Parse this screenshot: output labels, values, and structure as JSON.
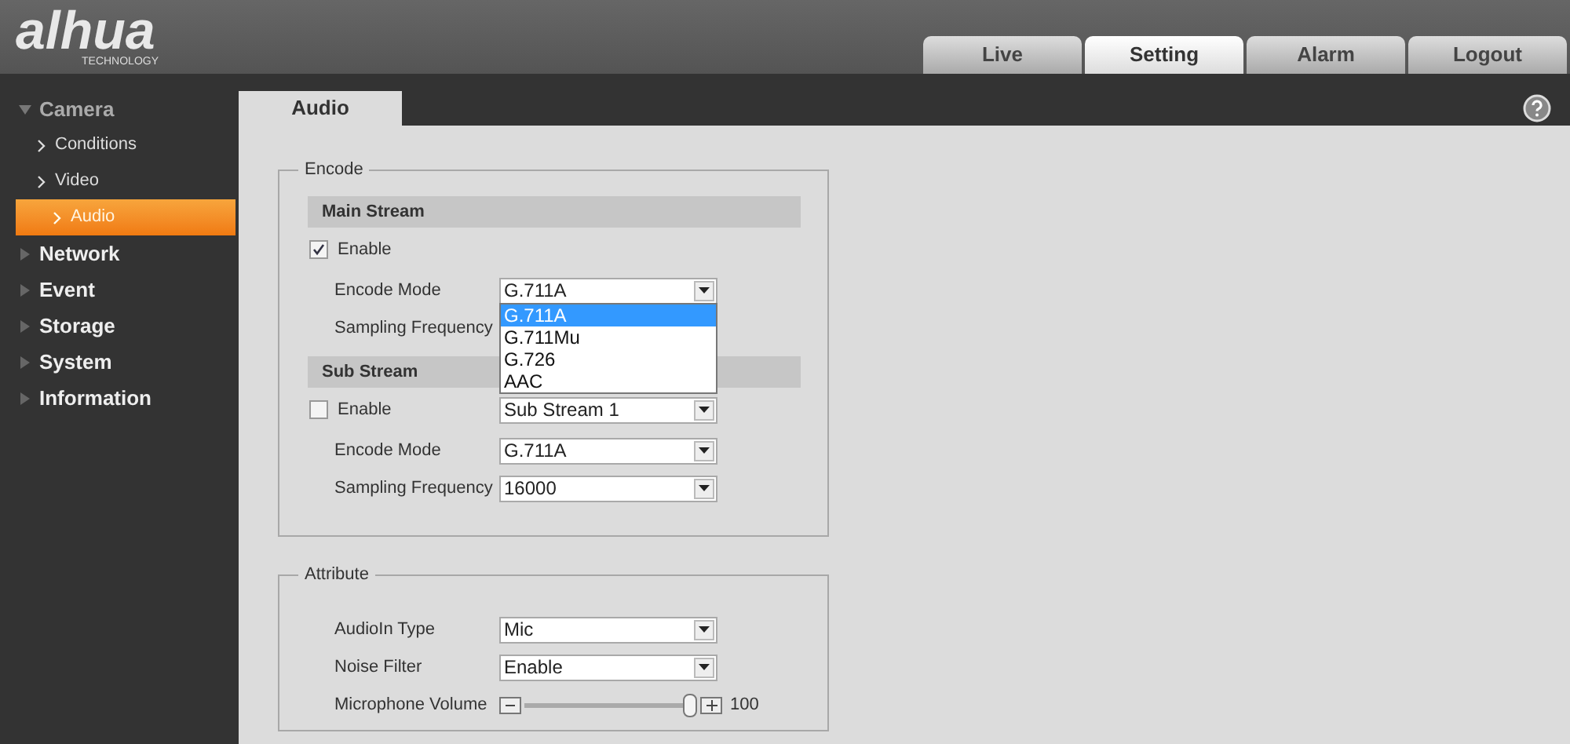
{
  "logo": {
    "name": "alhua",
    "tagline": "TECHNOLOGY"
  },
  "top_tabs": [
    {
      "label": "Live",
      "selected": false
    },
    {
      "label": "Setting",
      "selected": true
    },
    {
      "label": "Alarm",
      "selected": false
    },
    {
      "label": "Logout",
      "selected": false
    }
  ],
  "sidebar": [
    {
      "label": "Camera",
      "expanded": true,
      "children": [
        {
          "label": "Conditions",
          "selected": false
        },
        {
          "label": "Video",
          "selected": false
        },
        {
          "label": "Audio",
          "selected": true
        }
      ]
    },
    {
      "label": "Network",
      "expanded": false
    },
    {
      "label": "Event",
      "expanded": false
    },
    {
      "label": "Storage",
      "expanded": false
    },
    {
      "label": "System",
      "expanded": false
    },
    {
      "label": "Information",
      "expanded": false
    }
  ],
  "page_tab": "Audio",
  "encode": {
    "legend": "Encode",
    "streams": [
      {
        "title": "Main Stream",
        "enable": {
          "label": "Enable",
          "checked": true
        },
        "rows": [
          {
            "label": "Encode Mode",
            "value": "G.711A",
            "open": true,
            "options": [
              {
                "label": "G.711A",
                "selected": true
              },
              {
                "label": "G.711Mu",
                "selected": false
              },
              {
                "label": "G.726",
                "selected": false
              },
              {
                "label": "AAC",
                "selected": false
              }
            ]
          },
          {
            "label": "Sampling Frequency"
          }
        ]
      },
      {
        "title": "Sub Stream",
        "enable": {
          "label": "Enable",
          "checked": false,
          "value": "Sub Stream 1"
        },
        "rows": [
          {
            "label": "Encode Mode",
            "value": "G.711A",
            "open": false
          },
          {
            "label": "Sampling Frequency",
            "value": "16000",
            "open": false
          }
        ]
      }
    ]
  },
  "attribute": {
    "legend": "Attribute",
    "rows": [
      {
        "kind": "select",
        "label": "AudioIn Type",
        "value": "Mic"
      },
      {
        "kind": "select",
        "label": "Noise Filter",
        "value": "Enable"
      },
      {
        "kind": "slider",
        "label": "Microphone Volume",
        "level": 1,
        "reading": "100"
      }
    ]
  }
}
